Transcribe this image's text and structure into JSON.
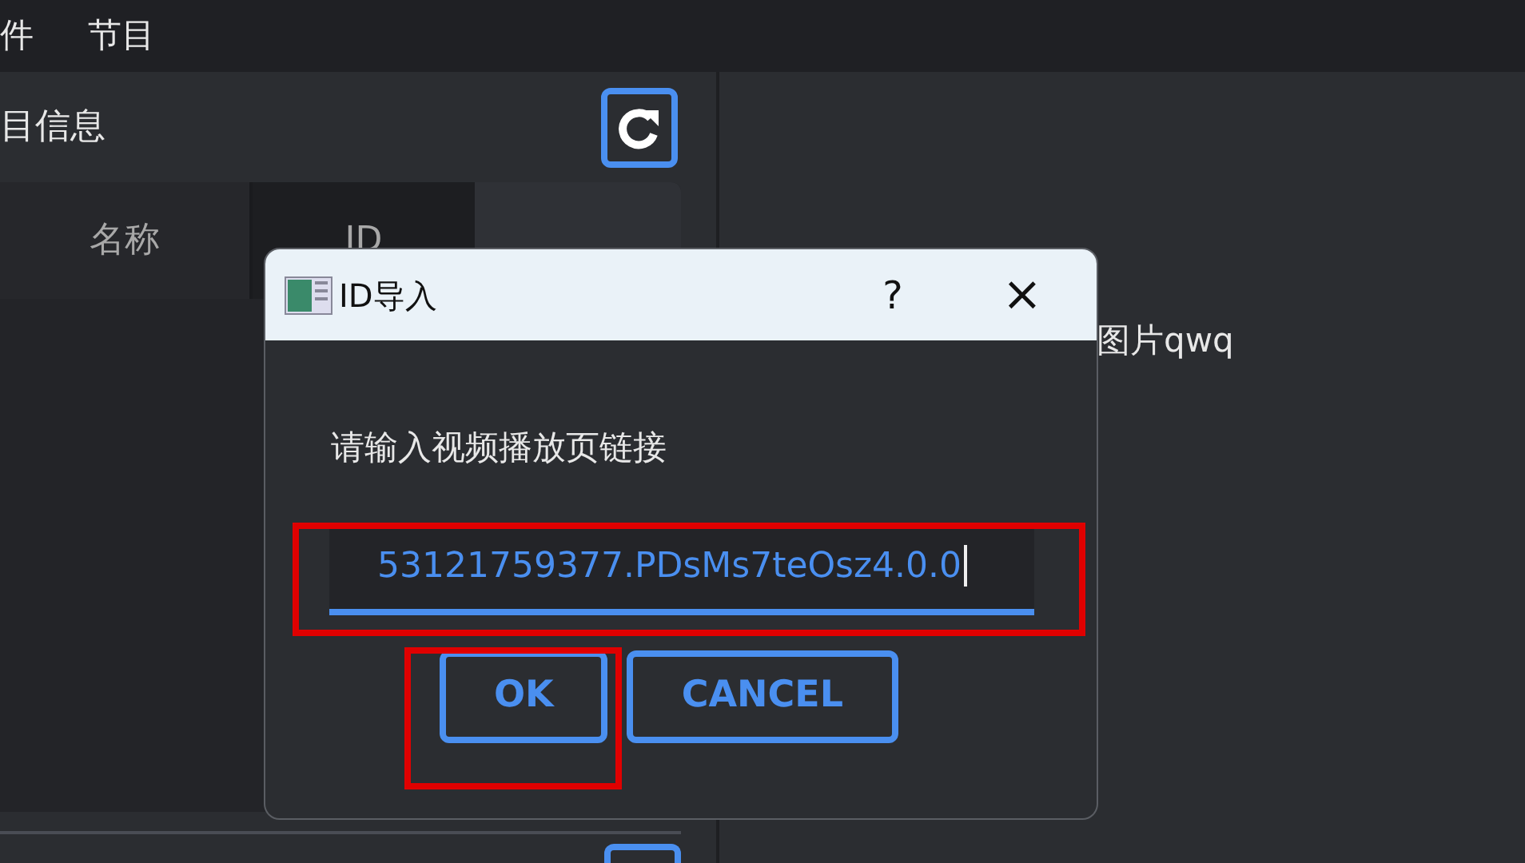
{
  "menu": [
    {
      "label": "件"
    },
    {
      "label": "节目"
    }
  ],
  "panel": {
    "title": "目信息",
    "table": {
      "columns": [
        {
          "label": "名称"
        },
        {
          "label": "ID"
        }
      ]
    }
  },
  "preview": {
    "text": "图片qwq"
  },
  "dialog": {
    "title": "ID导入",
    "help": "?",
    "close": "×",
    "prompt": "请输入视频播放页链接",
    "input": {
      "value": "53121759377.PDsMs7teOsz4.0.0",
      "focused": true,
      "highlighted": true
    },
    "buttons": [
      {
        "label": "OK",
        "highlighted": true
      },
      {
        "label": "CANCEL",
        "highlighted": false
      }
    ]
  }
}
